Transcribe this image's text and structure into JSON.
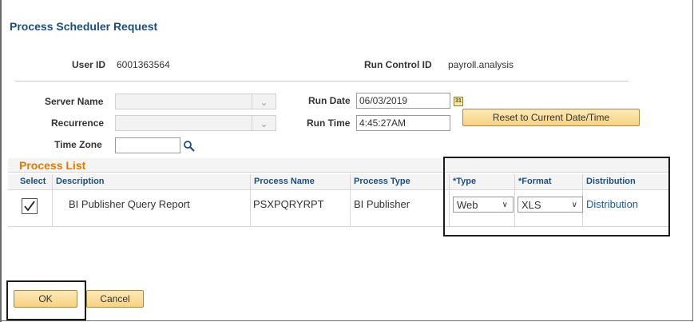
{
  "page": {
    "title": "Process Scheduler Request"
  },
  "header": {
    "user_id_label": "User ID",
    "user_id_value": "6001363564",
    "run_control_label": "Run Control ID",
    "run_control_value": "payroll.analysis"
  },
  "form": {
    "server_name_label": "Server Name",
    "server_name_value": "",
    "recurrence_label": "Recurrence",
    "recurrence_value": "",
    "time_zone_label": "Time Zone",
    "time_zone_value": "",
    "run_date_label": "Run Date",
    "run_date_value": "06/03/2019",
    "run_time_label": "Run Time",
    "run_time_value": "4:45:27AM",
    "reset_button_label": "Reset to Current Date/Time"
  },
  "process_list": {
    "title": "Process List",
    "columns": {
      "select": "Select",
      "description": "Description",
      "process_name": "Process Name",
      "process_type": "Process Type",
      "type": "*Type",
      "format": "*Format",
      "distribution": "Distribution"
    },
    "rows": [
      {
        "selected": true,
        "description": "BI Publisher Query Report",
        "process_name": "PSXPQRYRPT",
        "process_type": "BI Publisher",
        "type": "Web",
        "format": "XLS",
        "distribution_link": "Distribution"
      }
    ]
  },
  "footer": {
    "ok_label": "OK",
    "cancel_label": "Cancel"
  },
  "colors": {
    "title_blue": "#1c4e80",
    "section_orange": "#e17b00",
    "link_blue": "#1c5aa0",
    "button_fill": "#f8d283"
  },
  "icons": {
    "calendar": "calendar-icon",
    "lookup": "magnifier-icon",
    "dropdown": "chevron-down-icon",
    "checkbox": "checkmark-icon"
  }
}
